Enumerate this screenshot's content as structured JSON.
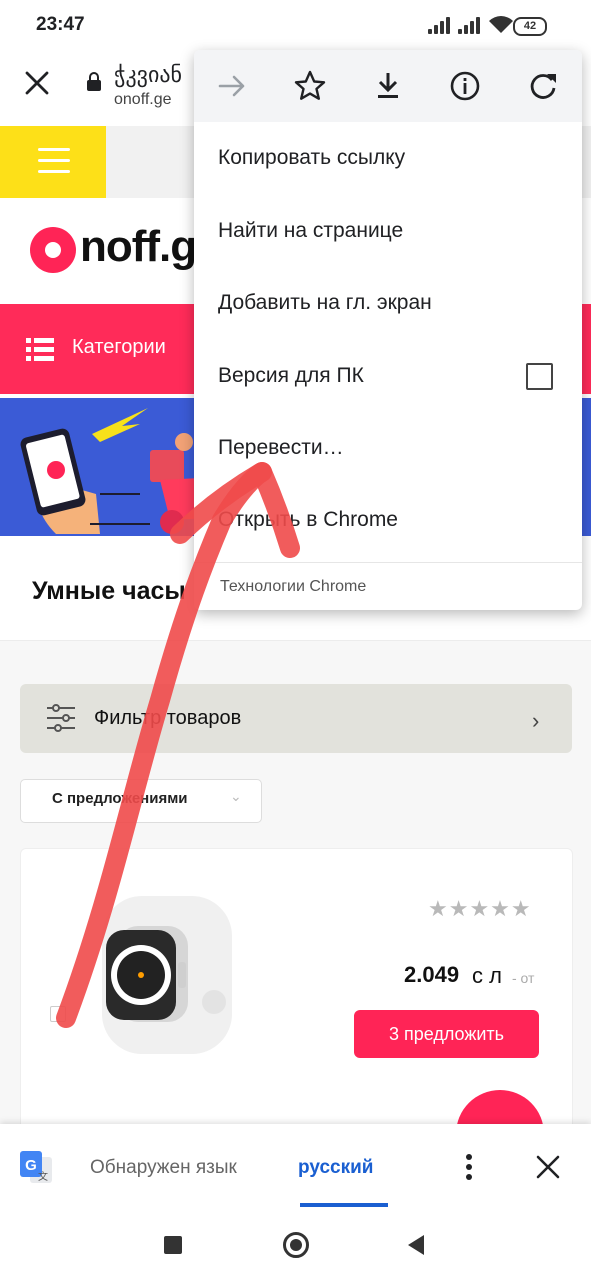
{
  "status_bar": {
    "time": "23:47",
    "battery": "42"
  },
  "url_bar": {
    "page_title": "ჭკვიან",
    "url": "onoff.ge"
  },
  "site": {
    "logo_text": "noff.ge",
    "categories_label": "Категории",
    "section_title": "Умные часы",
    "filter_label": "Фильтр товаров",
    "sort_label": "С предложениями",
    "product": {
      "rating": 0,
      "max_rating": 5,
      "price": "2.049",
      "currency": "с л",
      "price_suffix": "- от",
      "offers_button": "3 предложить"
    }
  },
  "menu": {
    "items": {
      "copy_link": "Копировать ссылку",
      "find_in_page": "Найти на странице",
      "add_to_home": "Добавить на гл. экран",
      "desktop_version": "Версия для ПК",
      "translate": "Перевести…",
      "open_in_chrome": "Открыть в Chrome"
    },
    "desktop_version_checked": false,
    "footer": "Технологии Chrome",
    "toolbar_icons": [
      "forward-icon",
      "star-icon",
      "download-icon",
      "info-icon",
      "refresh-icon"
    ]
  },
  "translate_bar": {
    "detected_label": "Обнаружен язык",
    "language": "русский"
  },
  "colors": {
    "brand_pink": "#ff2456",
    "brand_yellow": "#fde018",
    "banner_blue": "#3b5bd6",
    "translate_blue": "#1a5fd1",
    "annotation_red": "#f04a4a"
  }
}
